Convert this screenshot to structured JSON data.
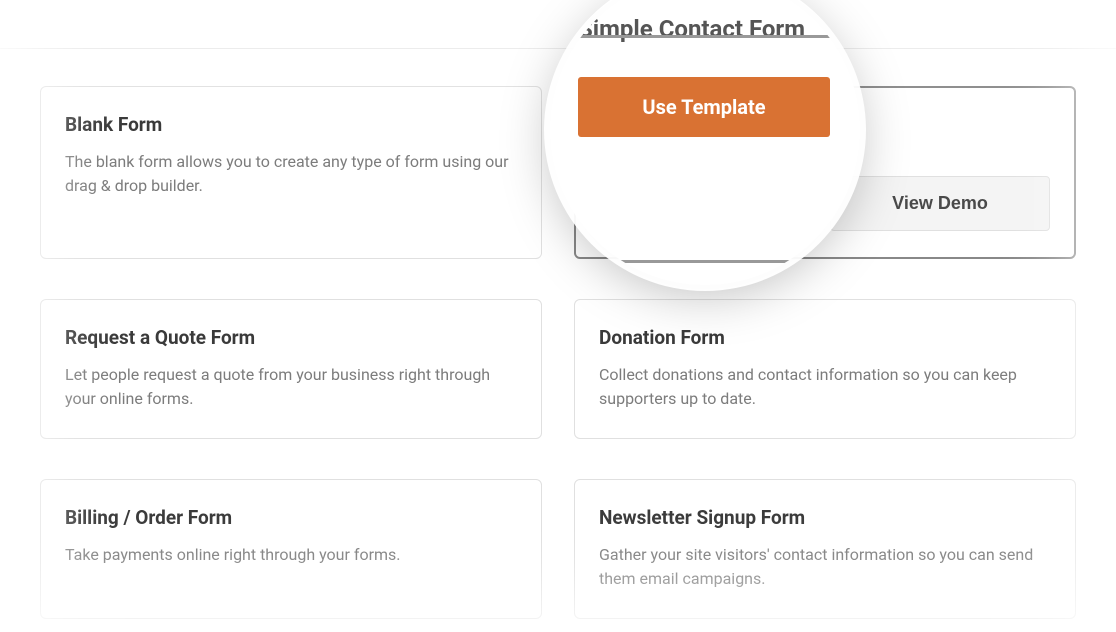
{
  "templates": [
    {
      "title": "Blank Form",
      "description": "The blank form allows you to create any type of form using our drag & drop builder."
    },
    {
      "title": "Simple Contact Form",
      "use_template_label": "Use Template",
      "view_demo_label": "View Demo"
    },
    {
      "title": "Request a Quote Form",
      "description": "Let people request a quote from your business right through your online forms."
    },
    {
      "title": "Donation Form",
      "description": "Collect donations and contact information so you can keep supporters up to date."
    },
    {
      "title": "Billing / Order Form",
      "description": "Take payments online right through your forms."
    },
    {
      "title": "Newsletter Signup Form",
      "description": "Gather your site visitors' contact information so you can send them email campaigns."
    }
  ],
  "lens": {
    "title": "Simple Contact Form",
    "button_label": "Use Template"
  }
}
